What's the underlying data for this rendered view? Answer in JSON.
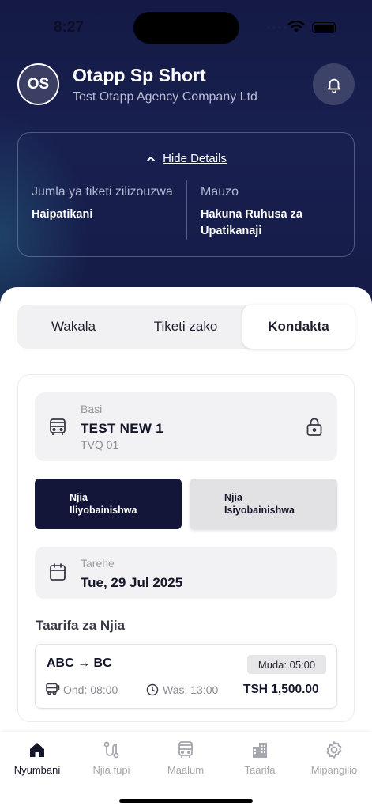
{
  "status_bar": {
    "time": "8:27"
  },
  "profile": {
    "initials": "OS",
    "name": "Otapp Sp Short",
    "company": "Test Otapp Agency Company Ltd"
  },
  "details": {
    "toggle_label": "Hide Details",
    "left_label": "Jumla ya tiketi zilizouzwa",
    "left_value": "Haipatikani",
    "right_label": "Mauzo",
    "right_value": "Hakuna Ruhusa za Upatikanaji"
  },
  "tabs": [
    {
      "label": "Wakala",
      "active": false
    },
    {
      "label": "Tiketi zako",
      "active": false
    },
    {
      "label": "Kondakta",
      "active": true
    }
  ],
  "bus": {
    "label": "Basi",
    "name": "TEST NEW 1",
    "plate": "TVQ 01"
  },
  "route_types": [
    {
      "line1": "Njia",
      "line2": "Iliyobainishwa",
      "selected": true
    },
    {
      "line1": "Njia",
      "line2": "Isiyobainishwa",
      "selected": false
    }
  ],
  "date": {
    "label": "Tarehe",
    "value": "Tue, 29 Jul 2025"
  },
  "routes_section": {
    "title": "Taarifa za Njia"
  },
  "trip": {
    "route": "ABC → BC",
    "duration": "Muda: 05:00",
    "departure": "Ond: 08:00",
    "arrival": "Was: 13:00",
    "price": "TSH 1,500.00"
  },
  "bottom_nav": [
    {
      "label": "Nyumbani",
      "icon": "home-icon",
      "active": true
    },
    {
      "label": "Njia fupi",
      "icon": "route-icon",
      "active": false
    },
    {
      "label": "Maalum",
      "icon": "bus-icon",
      "active": false
    },
    {
      "label": "Taarifa",
      "icon": "building-icon",
      "active": false
    },
    {
      "label": "Mipangilio",
      "icon": "gear-icon",
      "active": false
    }
  ],
  "colors": {
    "header_bg": "#161c48",
    "primary_dark": "#131539",
    "inactive_gray": "#a6a6ae"
  }
}
